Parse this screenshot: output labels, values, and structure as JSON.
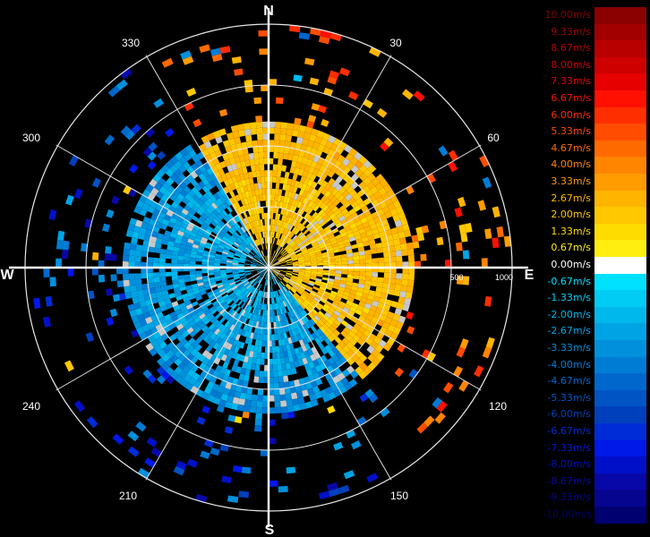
{
  "chart_data": {
    "type": "polar-radar",
    "title": "",
    "compass": {
      "north": "N",
      "east": "E",
      "south": "S",
      "west": "W"
    },
    "azimuth_labels": [
      "30",
      "60",
      "120",
      "150",
      "210",
      "240",
      "300",
      "330"
    ],
    "range_labels": [
      "500",
      "1000"
    ],
    "range_rings_count": 4,
    "colorbar": {
      "unit": "m/s",
      "levels": [
        {
          "label": "10.00m/s",
          "color": "#8b0000"
        },
        {
          "label": "9.33m/s",
          "color": "#a20000"
        },
        {
          "label": "8.67m/s",
          "color": "#b80000"
        },
        {
          "label": "8.00m/s",
          "color": "#cf0000"
        },
        {
          "label": "7.33m/s",
          "color": "#e60000"
        },
        {
          "label": "6.67m/s",
          "color": "#ff1000"
        },
        {
          "label": "6.00m/s",
          "color": "#ff2e00"
        },
        {
          "label": "5.33m/s",
          "color": "#ff4c00"
        },
        {
          "label": "4.67m/s",
          "color": "#ff6a00"
        },
        {
          "label": "4.00m/s",
          "color": "#ff8400"
        },
        {
          "label": "3.33m/s",
          "color": "#ff9c00"
        },
        {
          "label": "2.67m/s",
          "color": "#ffb400"
        },
        {
          "label": "2.00m/s",
          "color": "#ffc800"
        },
        {
          "label": "1.33m/s",
          "color": "#ffdc00"
        },
        {
          "label": "0.67m/s",
          "color": "#ffee10"
        },
        {
          "label": "0.00m/s",
          "color": "#ffffff"
        },
        {
          "label": "-0.67m/s",
          "color": "#00e0ff"
        },
        {
          "label": "-1.33m/s",
          "color": "#00ccf4"
        },
        {
          "label": "-2.00m/s",
          "color": "#00b8ec"
        },
        {
          "label": "-2.67m/s",
          "color": "#00a4e4"
        },
        {
          "label": "-3.33m/s",
          "color": "#0090dc"
        },
        {
          "label": "-4.00m/s",
          "color": "#007cd4"
        },
        {
          "label": "-4.67m/s",
          "color": "#0068cc"
        },
        {
          "label": "-5.33m/s",
          "color": "#0054c4"
        },
        {
          "label": "-6.00m/s",
          "color": "#0040bc"
        },
        {
          "label": "-6.67m/s",
          "color": "#002cd8"
        },
        {
          "label": "-7.33m/s",
          "color": "#0018e8"
        },
        {
          "label": "-8.00m/s",
          "color": "#0010c8"
        },
        {
          "label": "-8.67m/s",
          "color": "#0808a8"
        },
        {
          "label": "-9.33m/s",
          "color": "#050590"
        },
        {
          "label": "-10.00m/s",
          "color": "#000070"
        }
      ]
    },
    "pattern": {
      "description_free": true,
      "receding_sector_deg": [
        330,
        140
      ],
      "approaching_sector_deg": [
        150,
        320
      ],
      "dense_echo_range_fraction": 0.62
    }
  }
}
